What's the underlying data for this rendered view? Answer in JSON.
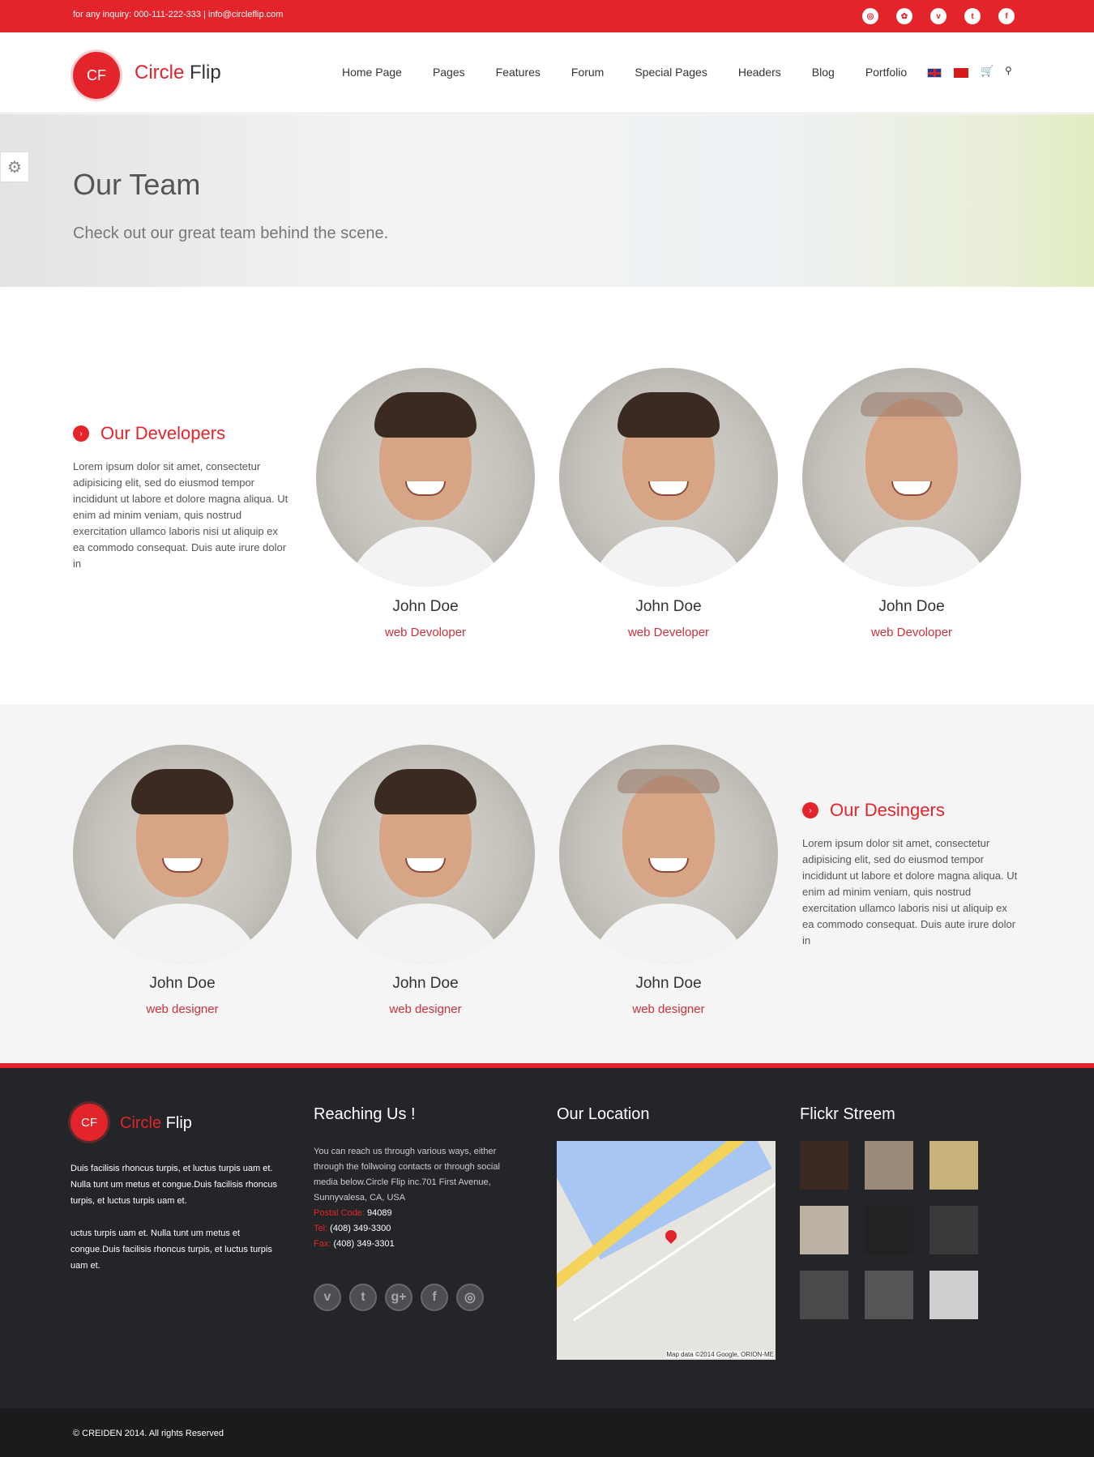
{
  "topbar": {
    "inquiry": "for any inquiry: 000-111-222-333 | info@circleflip.com",
    "social_icons": [
      "dribbble-icon",
      "flickr-icon",
      "vimeo-icon",
      "twitter-icon",
      "facebook-icon"
    ],
    "social_glyphs": [
      "◎",
      "✿",
      "v",
      "t",
      "f"
    ]
  },
  "header": {
    "logo_mark": "CF",
    "logo_word1": "Circle",
    "logo_word2": " Flip",
    "nav": [
      "Home Page",
      "Pages",
      "Features",
      "Forum",
      "Special Pages",
      "Headers",
      "Blog",
      "Portfolio"
    ],
    "cart_glyph": "🛒",
    "search_glyph": "⚲"
  },
  "hero": {
    "title": "Our Team",
    "subtitle": "Check out our great team behind the scene.",
    "settings_glyph": "⚙"
  },
  "developers": {
    "title": "Our Developers",
    "text": "Lorem ipsum dolor sit amet, consectetur adipisicing elit, sed do eiusmod tempor incididunt ut labore et dolore magna aliqua. Ut enim ad minim veniam, quis nostrud exercitation ullamco laboris nisi ut aliquip ex ea commodo consequat. Duis aute irure dolor in",
    "members": [
      {
        "name": "John Doe",
        "role": "web Devoloper"
      },
      {
        "name": "John Doe",
        "role": "web Developer"
      },
      {
        "name": "John Doe",
        "role": "web Devoloper"
      }
    ]
  },
  "designers": {
    "title": "Our Desingers",
    "text": "Lorem ipsum dolor sit amet, consectetur adipisicing elit, sed do eiusmod tempor incididunt ut labore et dolore magna aliqua. Ut enim ad minim veniam, quis nostrud exercitation ullamco laboris nisi ut aliquip ex ea commodo consequat. Duis aute irure dolor in",
    "members": [
      {
        "name": "John Doe",
        "role": "web designer"
      },
      {
        "name": "John Doe",
        "role": "web designer"
      },
      {
        "name": "John Doe",
        "role": "web designer"
      }
    ]
  },
  "footer": {
    "logo_mark": "CF",
    "logo_word1": "Circle",
    "logo_word2": " Flip",
    "about_p1": "Duis facilisis rhoncus turpis, et luctus turpis uam et. Nulla tunt um metus et congue.Duis facilisis rhoncus turpis, et luctus turpis uam et.",
    "about_p2": "uctus turpis uam et. Nulla tunt um metus et congue.Duis facilisis rhoncus turpis, et luctus turpis uam et.",
    "reach_title": "Reaching Us !",
    "reach_text": "You can reach us through various ways, either through the follwoing contacts or through social media below.Circle Flip inc.701 First Avenue, Sunnyvalesa, CA, USA",
    "postal_label": "Postal Code:",
    "postal_value": " 94089",
    "tel_label": "Tel:",
    "tel_value": " (408) 349-3300",
    "fax_label": "Fax:",
    "fax_value": " (408) 349-3301",
    "social_icons": [
      "vimeo-icon",
      "twitter-icon",
      "google-plus-icon",
      "facebook-icon",
      "dribbble-icon"
    ],
    "social_glyphs": [
      "v",
      "t",
      "g+",
      "f",
      "◎"
    ],
    "location_title": "Our Location",
    "map_credit": "Map data ©2014 Google, ORION-ME",
    "flickr_title": "Flickr Streem",
    "flickr_colors": [
      "#3a2a22",
      "#9b8a78",
      "#c9b27a",
      "#bdb2a6",
      "#222",
      "#3a3a3a",
      "#4a4a4a",
      "#555",
      "#cfcfcf"
    ],
    "copyright": "© CREIDEN 2014. All rights Reserved"
  }
}
